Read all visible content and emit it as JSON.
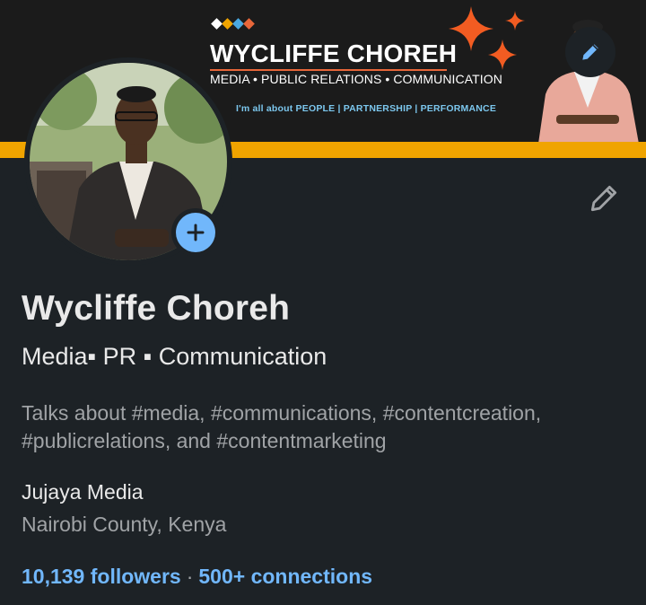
{
  "banner": {
    "title": "WYCLIFFE CHOREH",
    "subtitle": "MEDIA • PUBLIC RELATIONS • COMMUNICATION",
    "tagline": "I'm all about PEOPLE | PARTNERSHIP | PERFORMANCE",
    "diamond_colors": [
      "#ffffff",
      "#f0a400",
      "#4aa8e0",
      "#e8673a"
    ],
    "accent_color": "#f0a400",
    "star_color": "#f25c22",
    "edit_icon": "pencil-icon"
  },
  "profile": {
    "name": "Wycliffe Choreh",
    "headline": "Media▪ PR ▪ Communication",
    "about": "Talks about #media, #communications, #contentcreation, #publicrelations, and #contentmarketing",
    "company": "Jujaya Media",
    "location": "Nairobi County, Kenya",
    "followers": "10,139 followers",
    "separator": "·",
    "connections": "500+ connections",
    "add_icon": "plus-icon",
    "edit_icon": "pencil-icon"
  },
  "colors": {
    "background": "#1d2226",
    "link": "#71b7fb",
    "primary_text": "#e9e9e9",
    "secondary_text": "#a0a3a6"
  }
}
